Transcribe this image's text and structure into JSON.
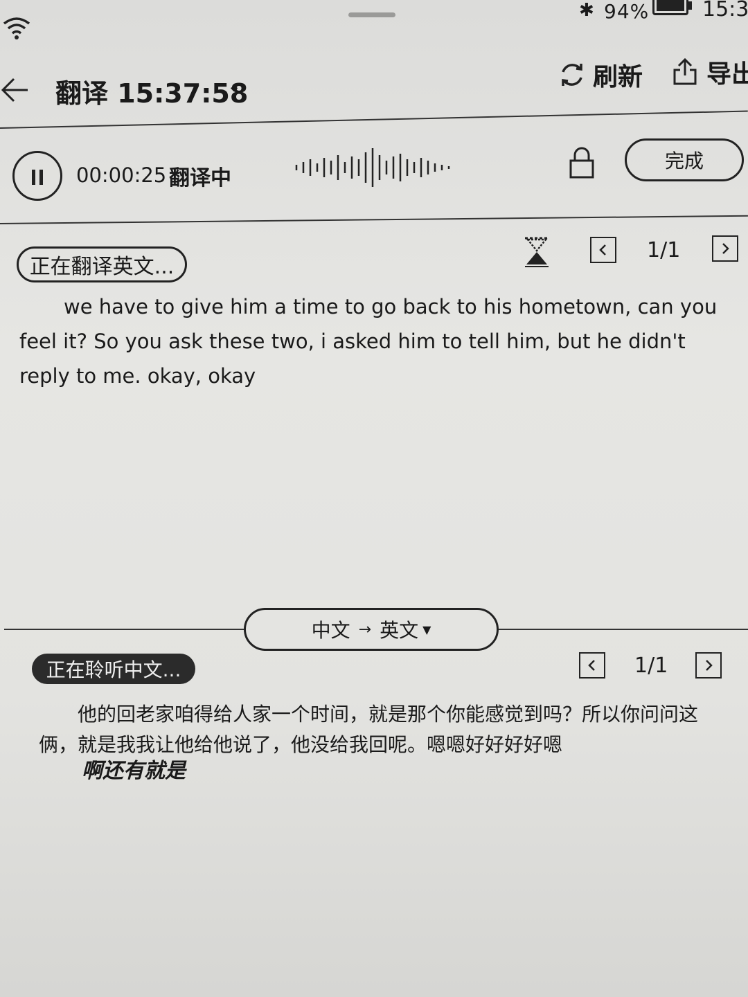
{
  "status_bar": {
    "battery": "94%",
    "time": "15:3"
  },
  "header": {
    "title": "翻译 15:37:58",
    "refresh_label": "刷新",
    "export_label": "导出"
  },
  "recorder": {
    "elapsed": "00:00:25",
    "status": "翻译中",
    "done_label": "完成"
  },
  "translation_panel": {
    "status_pill": "正在翻译英文...",
    "page": "1/1",
    "text": "we have to give him a time to go back to his hometown, can you feel it? So you ask these two, i asked him to tell him, but he didn't reply to me. okay, okay"
  },
  "language_switch": {
    "source": "中文",
    "target": "英文"
  },
  "transcript_panel": {
    "status_pill": "正在聆听中文...",
    "page": "1/1",
    "text": "他的回老家咱得给人家一个时间，就是那个你能感觉到吗？所以你问问这俩，就是我我让他给他说了，他没给我回呢。嗯嗯好好好好嗯",
    "live_text": "啊还有就是"
  }
}
